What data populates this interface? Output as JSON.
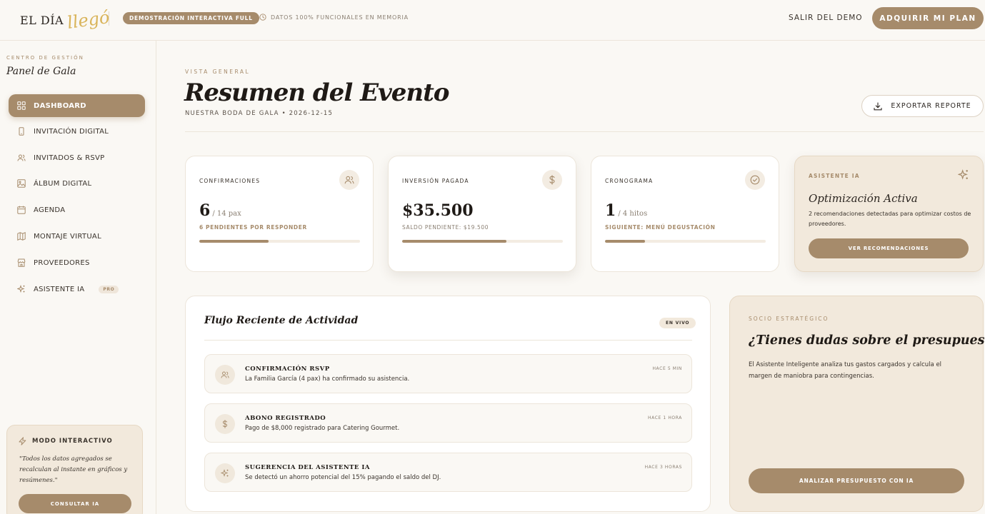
{
  "topbar": {
    "logo_main": "EL DÍA",
    "logo_script": "llegó",
    "demo_badge": "DEMOSTRACIÓN INTERACTIVA FULL",
    "memory_note": "DATOS 100% FUNCIONALES EN MEMORIA",
    "exit_demo": "SALIR DEL DEMO",
    "buy_plan": "ADQUIRIR MI PLAN"
  },
  "sidebar": {
    "kicker": "CENTRO DE GESTIÓN",
    "title": "Panel de Gala",
    "items": [
      {
        "label": "DASHBOARD",
        "icon": "grid-icon"
      },
      {
        "label": "INVITACIÓN DIGITAL",
        "icon": "phone-icon"
      },
      {
        "label": "INVITADOS & RSVP",
        "icon": "users-icon"
      },
      {
        "label": "ÁLBUM DIGITAL",
        "icon": "image-icon"
      },
      {
        "label": "AGENDA",
        "icon": "calendar-icon"
      },
      {
        "label": "MONTAJE VIRTUAL",
        "icon": "map-icon"
      },
      {
        "label": "PROVEEDORES",
        "icon": "store-icon"
      },
      {
        "label": "ASISTENTE IA",
        "icon": "sparkle-icon",
        "badge": "PRO"
      }
    ],
    "interactive": {
      "title": "MODO INTERACTIVO",
      "quote": "\"Todos los datos agregados se recalculan al instante en gráficos y resúmenes.\"",
      "button": "CONSULTAR IA"
    }
  },
  "header": {
    "kicker": "VISTA GENERAL",
    "title": "Resumen del Evento",
    "subtitle": "NUESTRA BODA DE GALA • 2026-12-15",
    "export": "EXPORTAR REPORTE"
  },
  "stats": {
    "confirmations": {
      "label": "CONFIRMACIONES",
      "value": "6",
      "total": "/ 14 pax",
      "note": "6 PENDIENTES POR RESPONDER",
      "progress": 0.43
    },
    "investment": {
      "label": "INVERSIÓN PAGADA",
      "value": "$35.500",
      "note": "SALDO PENDIENTE: $19.500",
      "progress": 0.65
    },
    "schedule": {
      "label": "CRONOGRAMA",
      "value": "1",
      "total": "/ 4 hitos",
      "note": "SIGUIENTE: MENÚ DEGUSTACIÓN",
      "progress": 0.25
    }
  },
  "ai_card": {
    "kicker": "ASISTENTE IA",
    "title": "Optimización Activa",
    "description": "2 recomendaciones detectadas para optimizar costos de proveedores.",
    "button": "VER RECOMENDACIONES"
  },
  "activity": {
    "title": "Flujo Reciente de Actividad",
    "badge": "EN VIVO",
    "items": [
      {
        "title": "CONFIRMACIÓN RSVP",
        "description": "La Familia García (4 pax) ha confirmado su asistencia.",
        "time": "HACE 5 MIN"
      },
      {
        "title": "ABONO REGISTRADO",
        "description": "Pago de $8,000 registrado para Catering Gourmet.",
        "time": "HACE 1 HORA"
      },
      {
        "title": "SUGERENCIA DEL ASISTENTE IA",
        "description": "Se detectó un ahorro potencial del 15% pagando el saldo del DJ.",
        "time": "HACE 3 HORAS"
      }
    ]
  },
  "partner": {
    "kicker": "SOCIO ESTRATÉGICO",
    "title": "¿Tienes dudas sobre el presupuesto?",
    "description": "El Asistente Inteligente analiza tus gastos cargados y calcula el margen de maniobra para contingencias.",
    "button": "ANALIZAR PRESUPUESTO CON IA"
  },
  "colors": {
    "accent": "#a68b6b",
    "background": "#faf8f4",
    "card_tint": "#f2e9dc",
    "logo_gold": "#d9b45a"
  }
}
